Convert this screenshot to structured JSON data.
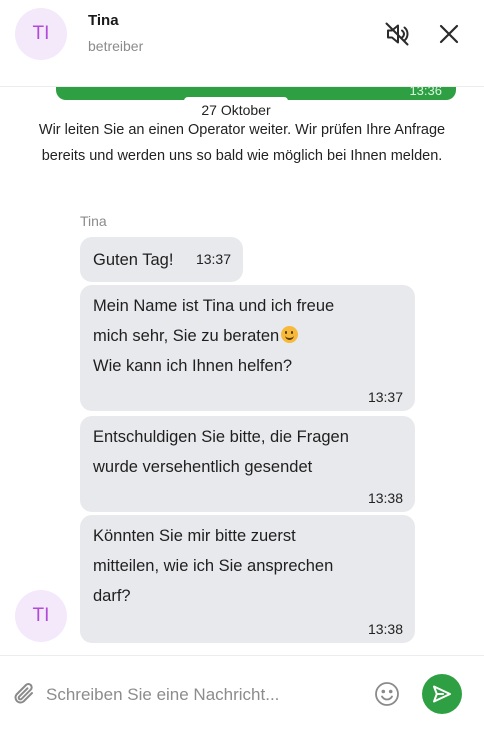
{
  "header": {
    "avatar_initials": "TI",
    "agent_name": "Tina",
    "agent_role": "betreiber",
    "mute_icon": "speaker-muted-icon",
    "close_icon": "close-icon"
  },
  "chat": {
    "prev_time": "13:36",
    "date_separator": "27 Oktober",
    "system_message": "Wir leiten Sie an einen Operator weiter. Wir prüfen Ihre Anfrage bereits und werden uns so bald wie möglich bei Ihnen melden.",
    "sender_name": "Tina",
    "messages": [
      {
        "text": "Guten Tag!",
        "time": "13:37"
      },
      {
        "text_line1": "Mein Name ist Tina und ich freue",
        "text_line2": "mich sehr, Sie zu beraten",
        "emoji": "smiling-face-emoji",
        "text_line3": "Wie kann ich Ihnen helfen?",
        "time": "13:37"
      },
      {
        "text": "Entschuldigen Sie bitte, die Fragen\nwurde versehentlich gesendet",
        "time": "13:38"
      },
      {
        "text": "Könnten Sie mir bitte zuerst\nmitteilen, wie ich Sie ansprechen\ndarf?",
        "time": "13:38"
      }
    ],
    "avatar_initials": "TI"
  },
  "composer": {
    "placeholder": "Schreiben Sie eine Nachricht...",
    "value": "",
    "attach_icon": "paperclip-icon",
    "emoji_icon": "smiley-icon",
    "send_icon": "send-icon"
  },
  "colors": {
    "accent_green": "#2ea043",
    "bubble_gray": "#e8e9ec",
    "avatar_bg": "#f3e9fb",
    "avatar_text": "#b14bd8"
  }
}
